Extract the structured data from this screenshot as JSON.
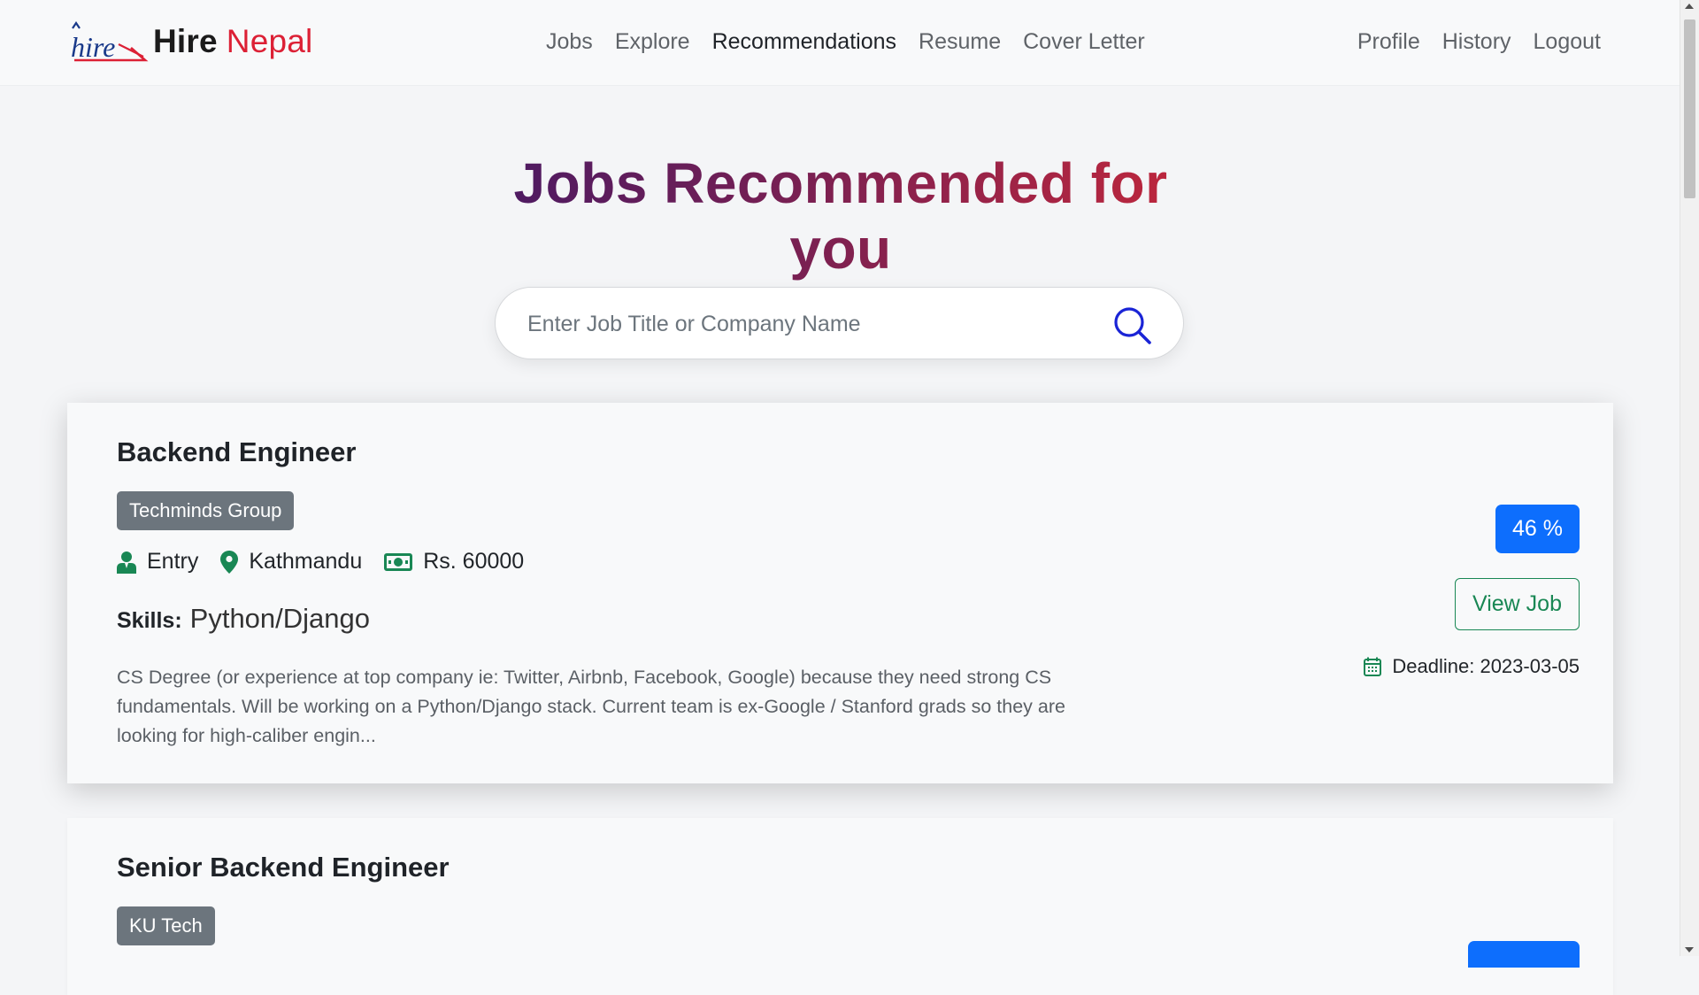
{
  "brand": {
    "hire": "Hire",
    "nepal": "Nepal",
    "logo_mark_text": "hire"
  },
  "nav": {
    "center": [
      "Jobs",
      "Explore",
      "Recommendations",
      "Resume",
      "Cover Letter"
    ],
    "active": "Recommendations",
    "right": [
      "Profile",
      "History",
      "Logout"
    ]
  },
  "page": {
    "title": "Jobs Recommended for you"
  },
  "search": {
    "placeholder": "Enter Job Title or Company Name",
    "value": ""
  },
  "jobs": [
    {
      "title": "Backend Engineer",
      "company": "Techminds Group",
      "level": "Entry",
      "location": "Kathmandu",
      "salary": "Rs. 60000",
      "skills_label": "Skills:",
      "skills": "Python/Django",
      "description": "CS Degree (or experience at top company ie: Twitter, Airbnb, Facebook, Google) because they need strong CS fundamentals.  Will be working on a Python/Django stack.  Current team is ex-Google / Stanford grads so they are looking for high-caliber engin...",
      "match": "46 %",
      "view_label": "View Job",
      "deadline": "Deadline: 2023-03-05"
    },
    {
      "title": "Senior Backend Engineer",
      "company": "KU Tech"
    }
  ],
  "colors": {
    "brand_red": "#dc2035",
    "title_gradient_start": "#4b1a63",
    "title_gradient_end": "#c0273c",
    "primary": "#0d6efd",
    "success": "#198754",
    "badge_gray": "#6c757d"
  },
  "icons": {
    "logo": "hire-logo-icon",
    "search": "search-icon",
    "level": "person-icon",
    "location": "map-pin-icon",
    "salary": "cash-icon",
    "deadline": "calendar-icon"
  }
}
